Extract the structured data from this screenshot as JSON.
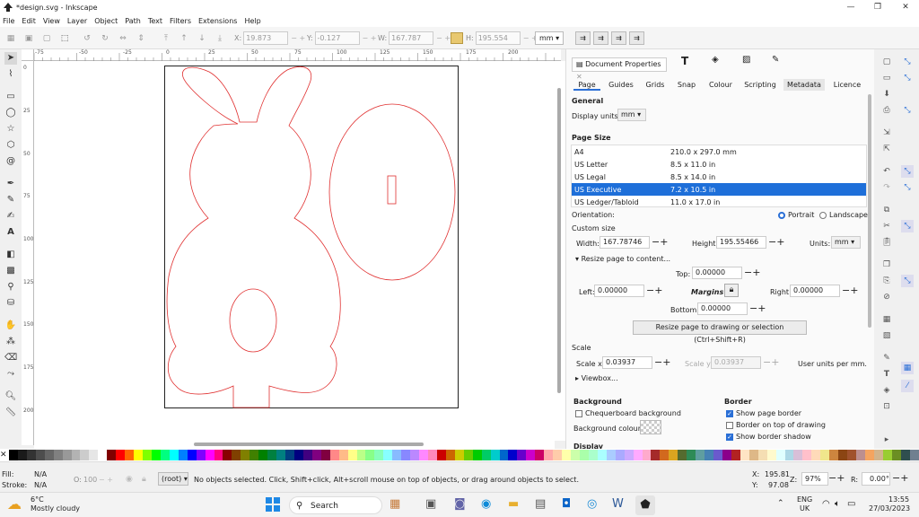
{
  "window": {
    "title": "*design.svg - Inkscape",
    "minimize": "—",
    "maximize": "❐",
    "close": "✕"
  },
  "menu": [
    "File",
    "Edit",
    "View",
    "Layer",
    "Object",
    "Path",
    "Text",
    "Filters",
    "Extensions",
    "Help"
  ],
  "toolbar": {
    "x_label": "X:",
    "x_value": "19.873",
    "y_label": "Y:",
    "y_value": "-0.127",
    "w_label": "W:",
    "w_value": "167.787",
    "h_label": "H:",
    "h_value": "195.554",
    "units": "mm"
  },
  "ruler_top": [
    "-75",
    "-50",
    "-25",
    "0",
    "25",
    "50",
    "75",
    "100",
    "125",
    "150",
    "175",
    "200"
  ],
  "ruler_left": [
    "0",
    "25",
    "50",
    "75",
    "100",
    "125",
    "150",
    "175",
    "200"
  ],
  "panel": {
    "tab_title": "Document Properties",
    "tabs": [
      "Page",
      "Guides",
      "Grids",
      "Snap",
      "Colour",
      "Scripting",
      "Metadata",
      "Licence"
    ],
    "general_heading": "General",
    "display_units_label": "Display units:",
    "display_units": "mm",
    "page_size_heading": "Page Size",
    "page_sizes": [
      {
        "name": "A4",
        "size": "210.0 x 297.0 mm",
        "selected": false
      },
      {
        "name": "US Letter",
        "size": "8.5 x 11.0 in",
        "selected": false
      },
      {
        "name": "US Legal",
        "size": "8.5 x 14.0 in",
        "selected": false
      },
      {
        "name": "US Executive",
        "size": "7.2 x 10.5 in",
        "selected": true
      },
      {
        "name": "US Ledger/Tabloid",
        "size": "11.0 x 17.0 in",
        "selected": false
      }
    ],
    "orientation_label": "Orientation:",
    "portrait": "Portrait",
    "landscape": "Landscape",
    "custom_size_heading": "Custom size",
    "width_label": "Width:",
    "width_value": "167.78746",
    "height_label": "Height:",
    "height_value": "195.55466",
    "units_label": "Units:",
    "units_value": "mm",
    "resize_expander": "Resize page to content...",
    "top_label": "Top:",
    "top_value": "0.00000",
    "left_label": "Left:",
    "left_value": "0.00000",
    "margins_label": "Margins",
    "right_label": "Right:",
    "right_value": "0.00000",
    "bottom_label": "Bottom:",
    "bottom_value": "0.00000",
    "resize_button": "Resize page to drawing or selection (Ctrl+Shift+R)",
    "scale_heading": "Scale",
    "scale_x_label": "Scale x:",
    "scale_x_value": "0.03937",
    "scale_y_label": "Scale y:",
    "scale_y_value": "0.03937",
    "user_units": "User units per mm.",
    "viewbox": "Viewbox...",
    "background_heading": "Background",
    "chequerboard": "Chequerboard background",
    "background_colour": "Background colour:",
    "border_heading": "Border",
    "show_page_border": "Show page border",
    "border_on_top": "Border on top of drawing",
    "show_border_shadow": "Show border shadow",
    "display_heading": "Display"
  },
  "status": {
    "fill_label": "Fill:",
    "fill_value": "N/A",
    "stroke_label": "Stroke:",
    "stroke_value": "N/A",
    "opacity_label": "O:",
    "opacity_value": "100",
    "layer": "(root)",
    "message": "No objects selected. Click, Shift+click, Alt+scroll mouse on top of objects, or drag around objects to select.",
    "x_label": "X:",
    "x_value": "195.81",
    "y_label": "Y:",
    "y_value": "97.08",
    "zoom_label": "Z:",
    "zoom_value": "97%",
    "rotation_label": "R:",
    "rotation_value": "0.00°"
  },
  "taskbar": {
    "weather_temp": "6°C",
    "weather_desc": "Mostly cloudy",
    "search_placeholder": "Search",
    "lang_top": "ENG",
    "lang_bottom": "UK",
    "time": "13:55",
    "date": "27/03/2023"
  },
  "colors": {
    "accent": "#2a6fd6",
    "shape_stroke": "#e03030",
    "selected_row": "#1e6fd9"
  }
}
